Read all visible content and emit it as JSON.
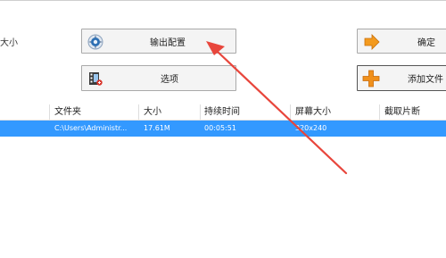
{
  "left_label": "大小",
  "buttons": {
    "output_config": "输出配置",
    "options": "选项",
    "confirm": "确定",
    "add_file": "添加文件"
  },
  "table": {
    "headers": [
      "文件夹",
      "大小",
      "持续时间",
      "屏幕大小",
      "截取片断"
    ],
    "rows": [
      {
        "folder": "C:\\Users\\Administr...",
        "size": "17.61M",
        "duration": "00:05:51",
        "screen": "320x240",
        "clip": ""
      }
    ]
  },
  "colors": {
    "selection": "#3399ff",
    "annotation_arrow": "#e8463c",
    "confirm_icon": "#f39a1e",
    "add_icon": "#f0901c"
  },
  "icons": {
    "output_config": "settings-disc-icon",
    "options": "film-options-icon",
    "confirm": "arrow-right-icon",
    "add_file": "plus-icon"
  }
}
